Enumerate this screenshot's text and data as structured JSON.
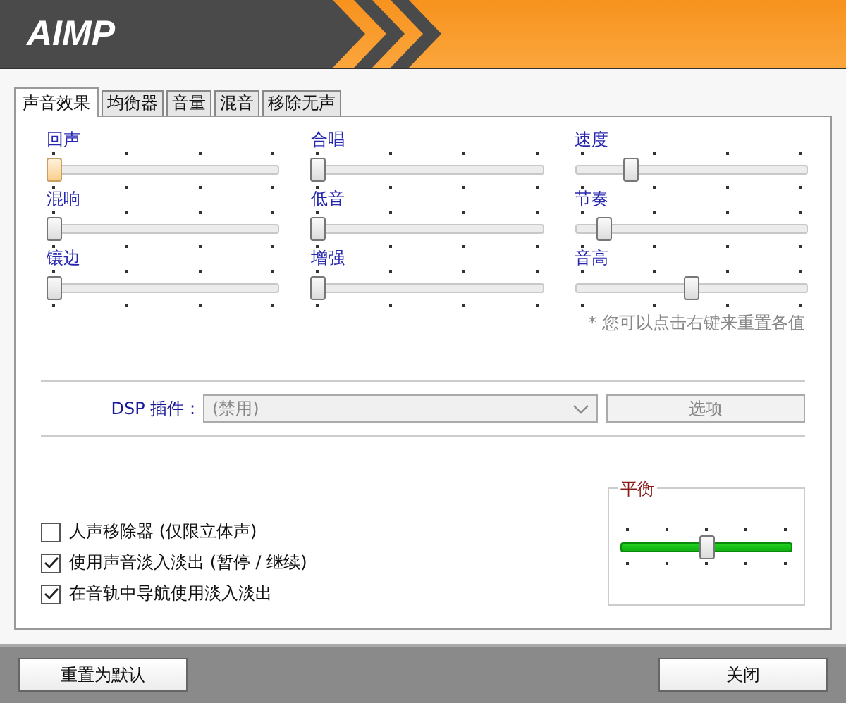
{
  "app": {
    "logo": "AIMP"
  },
  "tabs": [
    {
      "label": "声音效果",
      "selected": true
    },
    {
      "label": "均衡器",
      "selected": false
    },
    {
      "label": "音量",
      "selected": false
    },
    {
      "label": "混音",
      "selected": false
    },
    {
      "label": "移除无声",
      "selected": false
    }
  ],
  "effects": [
    {
      "label": "回声",
      "level": 0,
      "focused": true
    },
    {
      "label": "合唱",
      "level": 0,
      "focused": false
    },
    {
      "label": "速度",
      "level": 0.22,
      "focused": false
    },
    {
      "label": "混响",
      "level": 0,
      "focused": false
    },
    {
      "label": "低音",
      "level": 0,
      "focused": false
    },
    {
      "label": "节奏",
      "level": 0.1,
      "focused": false
    },
    {
      "label": "镶边",
      "level": 0,
      "focused": false
    },
    {
      "label": "增强",
      "level": 0,
      "focused": false
    },
    {
      "label": "音高",
      "level": 0.5,
      "focused": false
    }
  ],
  "hint": "* 您可以点击右键来重置各值",
  "dsp": {
    "label": "DSP 插件 :",
    "value": "(禁用)",
    "disabled": true,
    "button": "选项"
  },
  "options": [
    {
      "label": "人声移除器 (仅限立体声)",
      "checked": false
    },
    {
      "label": "使用声音淡入淡出 (暂停 / 继续)",
      "checked": true
    },
    {
      "label": "在音轨中导航使用淡入淡出",
      "checked": true
    }
  ],
  "balance": {
    "title": "平衡",
    "level": 0.5
  },
  "buttons": {
    "reset": "重置为默认",
    "close": "关闭"
  }
}
